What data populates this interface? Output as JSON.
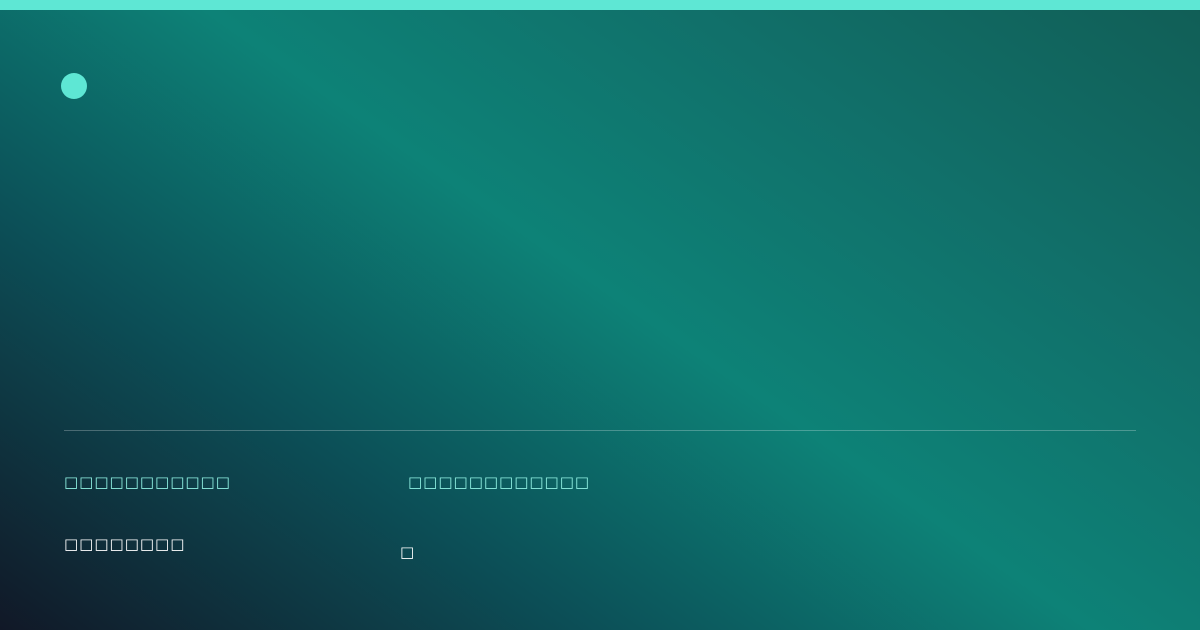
{
  "colors": {
    "accent": "#5ee7d4",
    "background_dark": "#111827",
    "background_teal": "#0d8277",
    "label_text": "#8ff0e2",
    "value_text": "#ffffff"
  },
  "brand": {
    "logo_icon": "dot-icon"
  },
  "meta": {
    "left_label": "□□□□□□□□□□□",
    "left_value": "□□□□□□□□",
    "right_label": "□□□□□□□□□□□□",
    "right_value": "□"
  }
}
